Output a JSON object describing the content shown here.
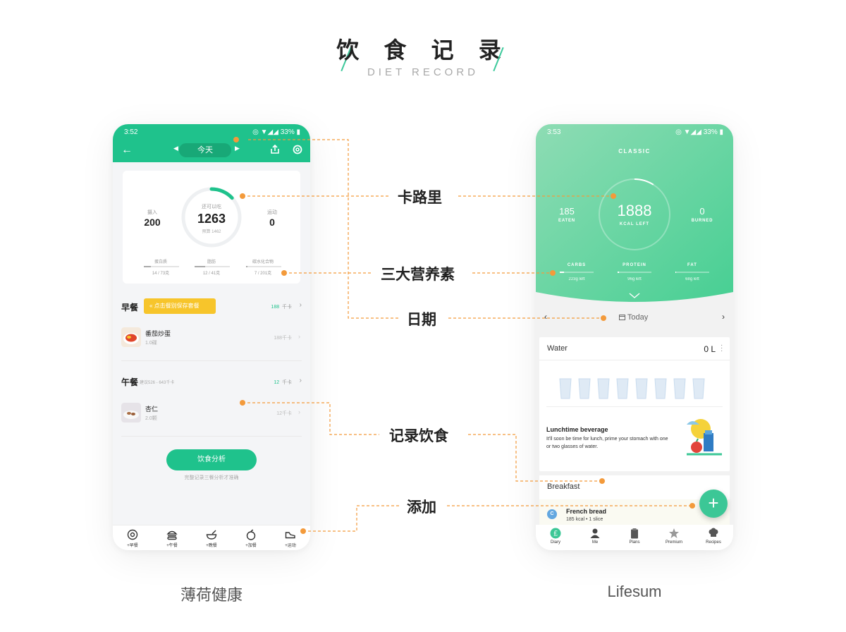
{
  "header": {
    "title": "饮 食 记 录",
    "subtitle": "DIET RECORD"
  },
  "left_app": {
    "caption": "薄荷健康",
    "status": {
      "time": "3:52",
      "system": "◎ ▼◢◢ 33% ▮"
    },
    "nav": {
      "back_icon": "arrow-left-icon",
      "date_label": "今天",
      "share_icon": "share-icon",
      "settings_icon": "settings-icon"
    },
    "summary": {
      "eaten_label": "摄入",
      "eaten_value": "200",
      "remaining_label": "还可以吃",
      "remaining_value": "1263",
      "budget_label": "预算 1462",
      "exercise_label": "运动",
      "exercise_value": "0",
      "ring_progress": 0.13,
      "macros": [
        {
          "label": "蛋白质",
          "value": "14 / 73克",
          "progress": 0.19
        },
        {
          "label": "脂肪",
          "value": "12 / 41克",
          "progress": 0.29
        },
        {
          "label": "碳水化合物",
          "value": "7 / 201克",
          "progress": 0.04
        }
      ]
    },
    "meals": [
      {
        "title": "早餐",
        "tag": "« 点击餐别保存套餐",
        "kcal": "188",
        "unit": "千卡",
        "foods": [
          {
            "name": "番茄炒蛋",
            "qty": "1.0碟",
            "kcal": "188千卡"
          }
        ]
      },
      {
        "title": "午餐",
        "suggest": "建议526 - 643千卡",
        "kcal": "12",
        "unit": "千卡",
        "foods": [
          {
            "name": "杏仁",
            "qty": "2.0颗",
            "kcal": "12千卡"
          }
        ]
      }
    ],
    "analyze_button": "饮食分析",
    "analyze_hint": "完整记录三餐分析才准确",
    "tabs": [
      {
        "label": "+早餐",
        "icon": "breakfast-icon"
      },
      {
        "label": "+午餐",
        "icon": "burger-icon"
      },
      {
        "label": "+晚餐",
        "icon": "bowl-icon"
      },
      {
        "label": "+加餐",
        "icon": "apple-icon"
      },
      {
        "label": "+运动",
        "icon": "shoe-icon"
      }
    ]
  },
  "right_app": {
    "caption": "Lifesum",
    "status": {
      "time": "3:53",
      "system": "◎ ▼◢◢ 33% ▮"
    },
    "diet_name": "CLASSIC",
    "eaten": {
      "value": "185",
      "label": "EATEN"
    },
    "kcal_left": {
      "value": "1888",
      "label": "KCAL LEFT"
    },
    "burned": {
      "value": "0",
      "label": "BURNED"
    },
    "ring_progress": 0.09,
    "macros": [
      {
        "label": "CARBS",
        "left": "223g left",
        "progress": 0.12
      },
      {
        "label": "PROTEIN",
        "left": "96g left",
        "progress": 0.05
      },
      {
        "label": "FAT",
        "left": "68g left",
        "progress": 0.02
      }
    ],
    "date": {
      "prev": "‹",
      "label": "Today",
      "next": "›"
    },
    "water": {
      "title": "Water",
      "value": "0 L",
      "glasses": 8,
      "tip_title": "Lunchtime beverage",
      "tip_text": "It'll soon be time for lunch, prime your stomach with one or two glasses of water."
    },
    "breakfast": {
      "title": "Breakfast",
      "item_badge": "C",
      "item_name": "French bread",
      "item_meta": "185 kcal • 1 slice"
    },
    "fab": "+",
    "tabs": [
      {
        "label": "Diary",
        "icon": "diary-icon"
      },
      {
        "label": "Me",
        "icon": "person-icon"
      },
      {
        "label": "Plans",
        "icon": "clipboard-icon"
      },
      {
        "label": "Premium",
        "icon": "star-icon"
      },
      {
        "label": "Recipes",
        "icon": "chef-hat-icon"
      }
    ]
  },
  "annotations": {
    "calories": "卡路里",
    "macros": "三大营养素",
    "date": "日期",
    "record": "记录饮食",
    "add": "添加"
  },
  "colors": {
    "mint_primary": "#1fc28c",
    "lifesum_green": "#3cc796",
    "accent_orange": "#f39a3b",
    "tag_yellow": "#f7c52b"
  }
}
